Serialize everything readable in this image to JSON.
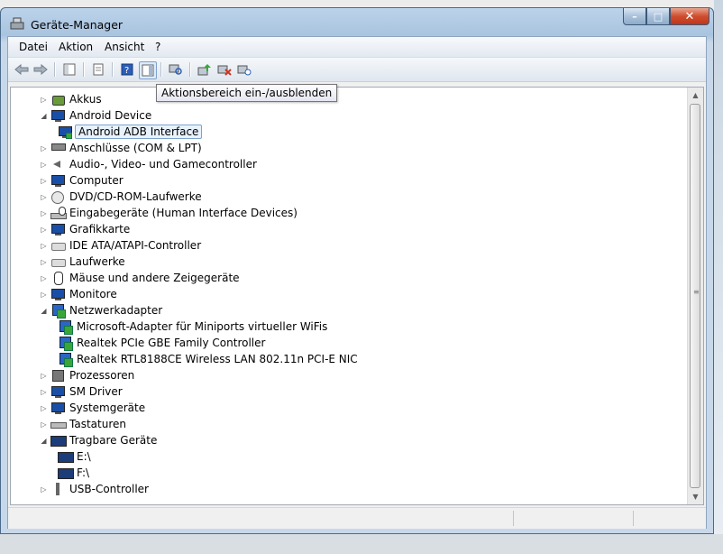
{
  "window": {
    "title": "Geräte-Manager",
    "minimize": "–",
    "maximize": "□",
    "close": "✕"
  },
  "menu": [
    {
      "label": "Datei"
    },
    {
      "label": "Aktion"
    },
    {
      "label": "Ansicht"
    },
    {
      "label": "?"
    }
  ],
  "toolbar": {
    "buttons": [
      "back-arrow-icon",
      "forward-arrow-icon",
      "console-tree-icon",
      "properties-icon",
      "help-icon",
      "action-pane-icon",
      "scan-hardware-icon",
      "update-driver-icon",
      "disable-device-icon",
      "uninstall-device-icon"
    ]
  },
  "tooltip": {
    "text": "Aktionsbereich ein-/ausblenden"
  },
  "tree": {
    "nodes": [
      {
        "label": "Akkus",
        "level": 0,
        "expanded": false,
        "icon": "battery-icon"
      },
      {
        "label": "Android Device",
        "level": 0,
        "expanded": true,
        "icon": "monitor-icon"
      },
      {
        "label": "Android ADB Interface",
        "level": 1,
        "icon": "device-icon",
        "selected": true
      },
      {
        "label": "Anschlüsse (COM & LPT)",
        "level": 0,
        "expanded": false,
        "icon": "port-icon"
      },
      {
        "label": "Audio-, Video- und Gamecontroller",
        "level": 0,
        "expanded": false,
        "icon": "speaker-icon"
      },
      {
        "label": "Computer",
        "level": 0,
        "expanded": false,
        "icon": "computer-icon"
      },
      {
        "label": "DVD/CD-ROM-Laufwerke",
        "level": 0,
        "expanded": false,
        "icon": "cd-drive-icon"
      },
      {
        "label": "Eingabegeräte (Human Interface Devices)",
        "level": 0,
        "expanded": false,
        "icon": "hid-icon"
      },
      {
        "label": "Grafikkarte",
        "level": 0,
        "expanded": false,
        "icon": "display-adapter-icon"
      },
      {
        "label": "IDE ATA/ATAPI-Controller",
        "level": 0,
        "expanded": false,
        "icon": "ide-controller-icon"
      },
      {
        "label": "Laufwerke",
        "level": 0,
        "expanded": false,
        "icon": "disk-drive-icon"
      },
      {
        "label": "Mäuse und andere Zeigegeräte",
        "level": 0,
        "expanded": false,
        "icon": "mouse-icon"
      },
      {
        "label": "Monitore",
        "level": 0,
        "expanded": false,
        "icon": "monitor-icon"
      },
      {
        "label": "Netzwerkadapter",
        "level": 0,
        "expanded": true,
        "icon": "network-icon"
      },
      {
        "label": "Microsoft-Adapter für Miniports virtueller WiFis",
        "level": 1,
        "icon": "network-adapter-icon"
      },
      {
        "label": "Realtek PCIe GBE Family Controller",
        "level": 1,
        "icon": "network-adapter-icon"
      },
      {
        "label": "Realtek RTL8188CE Wireless LAN 802.11n PCI-E NIC",
        "level": 1,
        "icon": "network-adapter-icon"
      },
      {
        "label": "Prozessoren",
        "level": 0,
        "expanded": false,
        "icon": "cpu-icon"
      },
      {
        "label": "SM Driver",
        "level": 0,
        "expanded": false,
        "icon": "computer-icon"
      },
      {
        "label": "Systemgeräte",
        "level": 0,
        "expanded": false,
        "icon": "computer-icon"
      },
      {
        "label": "Tastaturen",
        "level": 0,
        "expanded": false,
        "icon": "keyboard-icon"
      },
      {
        "label": "Tragbare Geräte",
        "level": 0,
        "expanded": true,
        "icon": "portable-device-icon"
      },
      {
        "label": "E:\\",
        "level": 1,
        "icon": "portable-device-icon"
      },
      {
        "label": "F:\\",
        "level": 1,
        "icon": "portable-device-icon"
      },
      {
        "label": "USB-Controller",
        "level": 0,
        "expanded": false,
        "icon": "usb-icon"
      }
    ]
  },
  "colors": {
    "selection_border": "#7da2ce",
    "selection_fill": "#e8f2fd",
    "close_button": "#c1361a"
  }
}
